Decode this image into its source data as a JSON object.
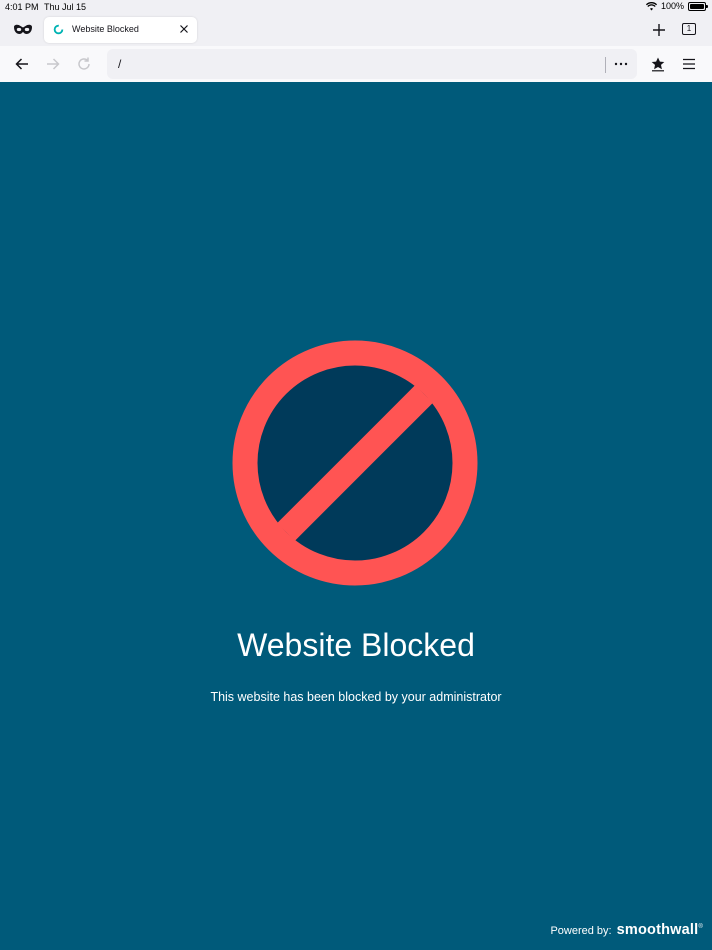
{
  "status_bar": {
    "time": "4:01 PM",
    "date": "Thu Jul 15",
    "battery": "100%",
    "icons": [
      "wifi-icon",
      "battery-icon"
    ]
  },
  "tabs": {
    "active": {
      "title": "Website Blocked",
      "favicon": "loading-spinner-icon"
    },
    "count": "1"
  },
  "toolbar": {
    "url": "/",
    "icons": [
      "private-browsing-icon",
      "back-arrow-icon",
      "forward-arrow-icon",
      "reload-icon",
      "more-options-icon",
      "bookmark-star-icon",
      "hamburger-menu-icon",
      "new-tab-plus-icon",
      "close-tab-icon"
    ]
  },
  "page": {
    "heading": "Website Blocked",
    "message": "This website has been blocked by your administrator",
    "icon": "blocked-prohibition-icon",
    "footer_label": "Powered by:",
    "footer_brand": "smoothwall"
  },
  "colors": {
    "background": "#005a7a",
    "prohibition_ring": "#ff5453",
    "prohibition_fill": "#003a5a",
    "spinner": "#00b3b3"
  }
}
